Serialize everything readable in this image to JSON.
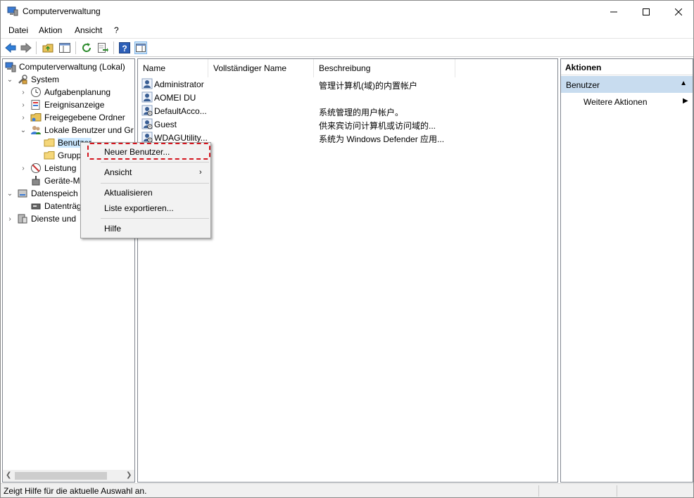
{
  "window": {
    "title": "Computerverwaltung"
  },
  "menu": [
    "Datei",
    "Aktion",
    "Ansicht",
    "?"
  ],
  "tree": {
    "root": "Computerverwaltung (Lokal)",
    "system": "System",
    "task_scheduler": "Aufgabenplanung",
    "event_viewer": "Ereignisanzeige",
    "shared_folders": "Freigegebene Ordner",
    "local_users": "Lokale Benutzer und Gr",
    "users": "Benutzer",
    "groups": "Grupp",
    "performance": "Leistung",
    "device_manager": "Geräte-M",
    "storage": "Datenspeich",
    "disk_management": "Datenträg",
    "services": "Dienste und"
  },
  "list": {
    "columns": [
      "Name",
      "Vollständiger Name",
      "Beschreibung"
    ],
    "rows": [
      {
        "name": "Administrator",
        "description": "管理计算机(域)的内置帐户"
      },
      {
        "name": "AOMEI DU",
        "description": ""
      },
      {
        "name": "DefaultAcco...",
        "description": "系统管理的用户帐户。"
      },
      {
        "name": "Guest",
        "description": "供来宾访问计算机或访问域的..."
      },
      {
        "name": "WDAGUtility...",
        "description": "系统为 Windows Defender 应用..."
      }
    ]
  },
  "actions": {
    "header": "Aktionen",
    "section": "Benutzer",
    "more": "Weitere Aktionen"
  },
  "context_menu": {
    "new_user": "Neuer Benutzer...",
    "view": "Ansicht",
    "refresh": "Aktualisieren",
    "export": "Liste exportieren...",
    "help": "Hilfe"
  },
  "status": {
    "text": "Zeigt Hilfe für die aktuelle Auswahl an."
  },
  "colors": {
    "selection": "#cce8ff",
    "action_section": "#c8dcef",
    "highlight": "#d4151e"
  }
}
